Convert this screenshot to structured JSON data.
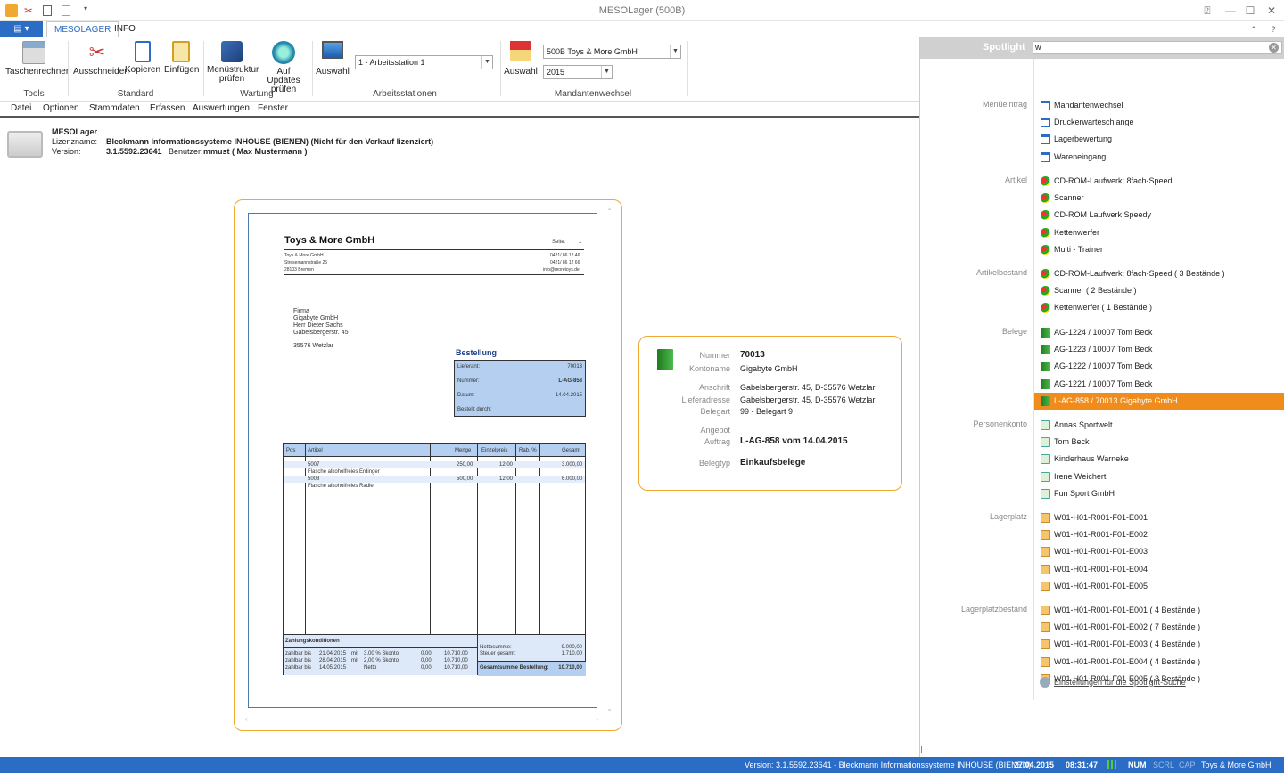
{
  "window": {
    "title": "MESOLager (500B)"
  },
  "tabs": {
    "file_label": "▤ ▾",
    "mesolager": "MESOLAGER",
    "info": "INFO"
  },
  "ribbon": {
    "tools": {
      "calc": "Taschenrechner",
      "label": "Tools"
    },
    "standard": {
      "cut": "Ausschneiden",
      "copy": "Kopieren",
      "paste": "Einfügen",
      "label": "Standard"
    },
    "wartung": {
      "menu_check": "Menüstruktur prüfen",
      "update_check": "Auf Updates prüfen",
      "label": "Wartung"
    },
    "arbeitsstationen": {
      "select": "Auswahl",
      "value": "1 - Arbeitsstation 1",
      "label": "Arbeitsstationen"
    },
    "mandanten": {
      "select": "Auswahl",
      "company": "500B Toys & More GmbH",
      "year": "2015",
      "label": "Mandantenwechsel"
    }
  },
  "menu": [
    "Datei",
    "Optionen",
    "Stammdaten",
    "Erfassen",
    "Auswertungen",
    "Fenster"
  ],
  "info": {
    "app": "MESOLager",
    "license_label": "Lizenzname:",
    "license_value": "Bleckmann Informationssysteme INHOUSE (BIENEN) (Nicht für den Verkauf lizenziert)",
    "version_label": "Version:",
    "version_value": "3.1.5592.23641",
    "user_label": "Benutzer:",
    "user_value": "mmust ( Max Mustermann )"
  },
  "doc": {
    "company": "Toys & More GmbH",
    "page_label": "Seite:",
    "page_no": "1",
    "sender_lines": [
      "Toys & More GmbH",
      "Stresemannstraße 25",
      "28103     Bremen"
    ],
    "contact_lines": [
      "0421/ 86 12 46",
      "0421/ 86 12 66",
      "info@moretoys.de"
    ],
    "address": [
      "Firma",
      "Gigabyte GmbH",
      "Herr Dieter Sachs",
      "Gabelsbergerstr. 45",
      "",
      "35576 Wetzlar"
    ],
    "order_title": "Bestellung",
    "order_fields": [
      {
        "k": "Lieferant:",
        "v": "70013"
      },
      {
        "k": "Nummer:",
        "v": "L-AG-858"
      },
      {
        "k": "Datum:",
        "v": "14.04.2015"
      },
      {
        "k": "Bestellt durch:",
        "v": ""
      }
    ],
    "table_headers": [
      "Pos",
      "Artikel",
      "Menge",
      "Einzelpreis",
      "Rab. %",
      "Gesamt"
    ],
    "rows": [
      {
        "art": "5007",
        "sub": "Flasche alkoholfreies Erdinger",
        "menge": "250,00",
        "ep": "12,00",
        "ges": "3.000,00"
      },
      {
        "art": "5008",
        "sub": "Flasche alkoholfreies Radler",
        "menge": "500,00",
        "ep": "12,00",
        "ges": "6.000,00"
      }
    ],
    "payment_title": "Zahlungskonditionen",
    "payments": [
      {
        "a": "zahlbar bis",
        "d": "21.04.2015",
        "m": "mit",
        "p": "3,00 % Skonto",
        "x": "0,00",
        "t": "10.710,00"
      },
      {
        "a": "zahlbar bis",
        "d": "28.04.2015",
        "m": "mit",
        "p": "2,00 % Skonto",
        "x": "0,00",
        "t": "10.710,00"
      },
      {
        "a": "zahlbar bis",
        "d": "14.05.2015",
        "m": "",
        "p": "Netto",
        "x": "0,00",
        "t": "10.710,00"
      }
    ],
    "totals": [
      {
        "k": "Nettosumme:",
        "v": "9.000,00"
      },
      {
        "k": "Steuer gesamt:",
        "v": "1.710,00"
      }
    ],
    "grand_label": "Gesamtsumme Bestellung:",
    "grand_value": "10.710,00"
  },
  "tooltip": {
    "fields": [
      {
        "k": "Nummer",
        "v": "70013",
        "bold": true
      },
      {
        "k": "Kontoname",
        "v": "Gigabyte GmbH"
      },
      {
        "k": "Anschrift",
        "v": "Gabelsbergerstr. 45, D-35576 Wetzlar"
      },
      {
        "k": "Lieferadresse",
        "v": "Gabelsbergerstr. 45, D-35576 Wetzlar"
      },
      {
        "k": "Belegart",
        "v": "99 - Belegart 9"
      },
      {
        "k": "Angebot",
        "v": ""
      },
      {
        "k": "Auftrag",
        "v": "L-AG-858 vom 14.04.2015",
        "bold": true
      },
      {
        "k": "Belegtyp",
        "v": "Einkaufsbelege",
        "bold": true
      }
    ]
  },
  "spotlight": {
    "title": "Spotlight",
    "query": "w",
    "categories": {
      "menu": "Menüeintrag",
      "artikel": "Artikel",
      "artikelbestand": "Artikelbestand",
      "belege": "Belege",
      "personenkonto": "Personenkonto",
      "lagerplatz": "Lagerplatz",
      "lagerplatzbestand": "Lagerplatzbestand"
    },
    "menu": [
      "Mandantenwechsel",
      "Druckerwarteschlange",
      "Lagerbewertung",
      "Wareneingang"
    ],
    "artikel": [
      "CD-ROM-Laufwerk; 8fach-Speed",
      "Scanner",
      "CD-ROM Laufwerk Speedy",
      "Kettenwerfer",
      "Multi - Trainer"
    ],
    "artikelbestand": [
      "CD-ROM-Laufwerk; 8fach-Speed  ( 3 Bestände )",
      "Scanner   ( 2 Bestände )",
      "Kettenwerfer   ( 1 Bestände )"
    ],
    "belege": [
      "AG-1224 / 10007 Tom Beck",
      "AG-1223 / 10007 Tom Beck",
      "AG-1222 / 10007 Tom Beck",
      "AG-1221 / 10007 Tom Beck",
      "L-AG-858 / 70013 Gigabyte GmbH"
    ],
    "personenkonto": [
      "Annas Sportwelt",
      "Tom Beck",
      "Kinderhaus Warneke",
      "Irene Weichert",
      "Fun Sport GmbH"
    ],
    "lagerplatz": [
      "W01-H01-R001-F01-E001",
      "W01-H01-R001-F01-E002",
      "W01-H01-R001-F01-E003",
      "W01-H01-R001-F01-E004",
      "W01-H01-R001-F01-E005"
    ],
    "lagerplatzbestand": [
      "W01-H01-R001-F01-E001  ( 4 Bestände )",
      "W01-H01-R001-F01-E002  ( 7 Bestände )",
      "W01-H01-R001-F01-E003  ( 4 Bestände )",
      "W01-H01-R001-F01-E004  ( 4 Bestände )",
      "W01-H01-R001-F01-E005  ( 3 Bestände )"
    ],
    "settings_link": "Einstellungen für die Spotlight-Suche"
  },
  "status": {
    "version": "Version: 3.1.5592.23641 - Bleckmann Informationssysteme INHOUSE (BIENEN)",
    "date": "27.04.2015",
    "time": "08:31:47",
    "num": "NUM",
    "scrl": "SCRL",
    "cap": "CAP",
    "company": "Toys & More GmbH"
  },
  "colors": {
    "accent": "#2b6cc4",
    "highlight": "#f08c1c",
    "border_orange": "#f0a830",
    "doc_blue": "#b4cff0"
  }
}
